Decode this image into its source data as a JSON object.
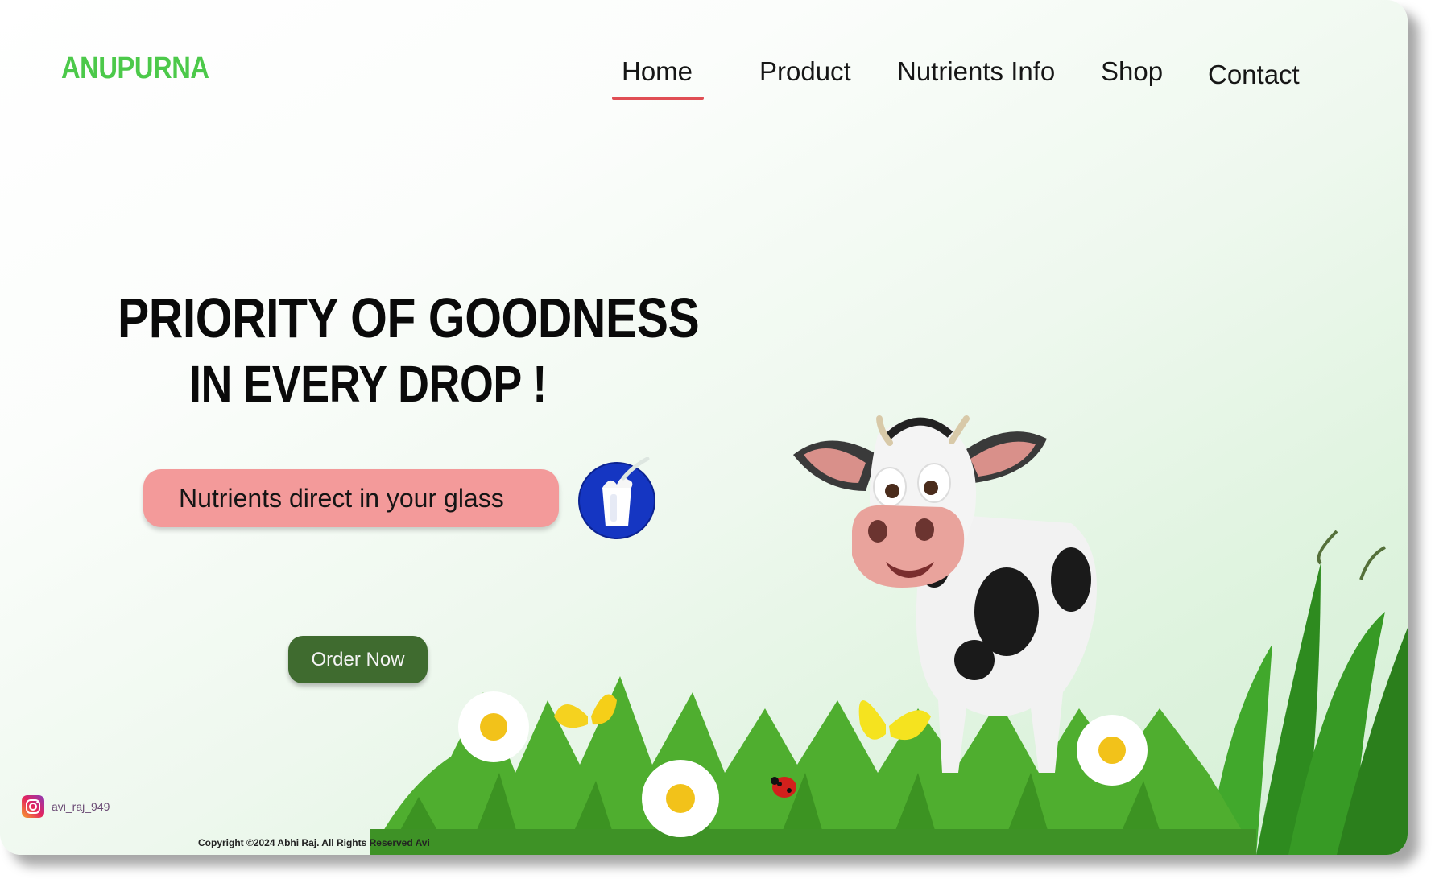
{
  "brand": {
    "name": "ANUPURNA"
  },
  "nav": {
    "items": [
      {
        "label": "Home",
        "active": true
      },
      {
        "label": "Product"
      },
      {
        "label": "Nutrients Info"
      },
      {
        "label": "Shop"
      },
      {
        "label": "Contact"
      }
    ]
  },
  "hero": {
    "headline_line1": "PRIORITY OF GOODNESS",
    "headline_line2": "IN EVERY DROP !",
    "tagline": "Nutrients direct in your glass",
    "cta_label": "Order Now"
  },
  "social": {
    "instagram_handle": "avi_raj_949"
  },
  "footer": {
    "copyright": "Copyright ©2024 Abhi Raj. All Rights Reserved  Avi"
  },
  "icons": {
    "milk": "milk-glass-icon",
    "instagram": "instagram-icon"
  },
  "colors": {
    "brand": "#4cc94a",
    "nav_underline": "#e04e54",
    "tagline_bg": "#f39a9a",
    "cta_bg": "#3f6b2f",
    "milk_badge": "#1536c2"
  }
}
